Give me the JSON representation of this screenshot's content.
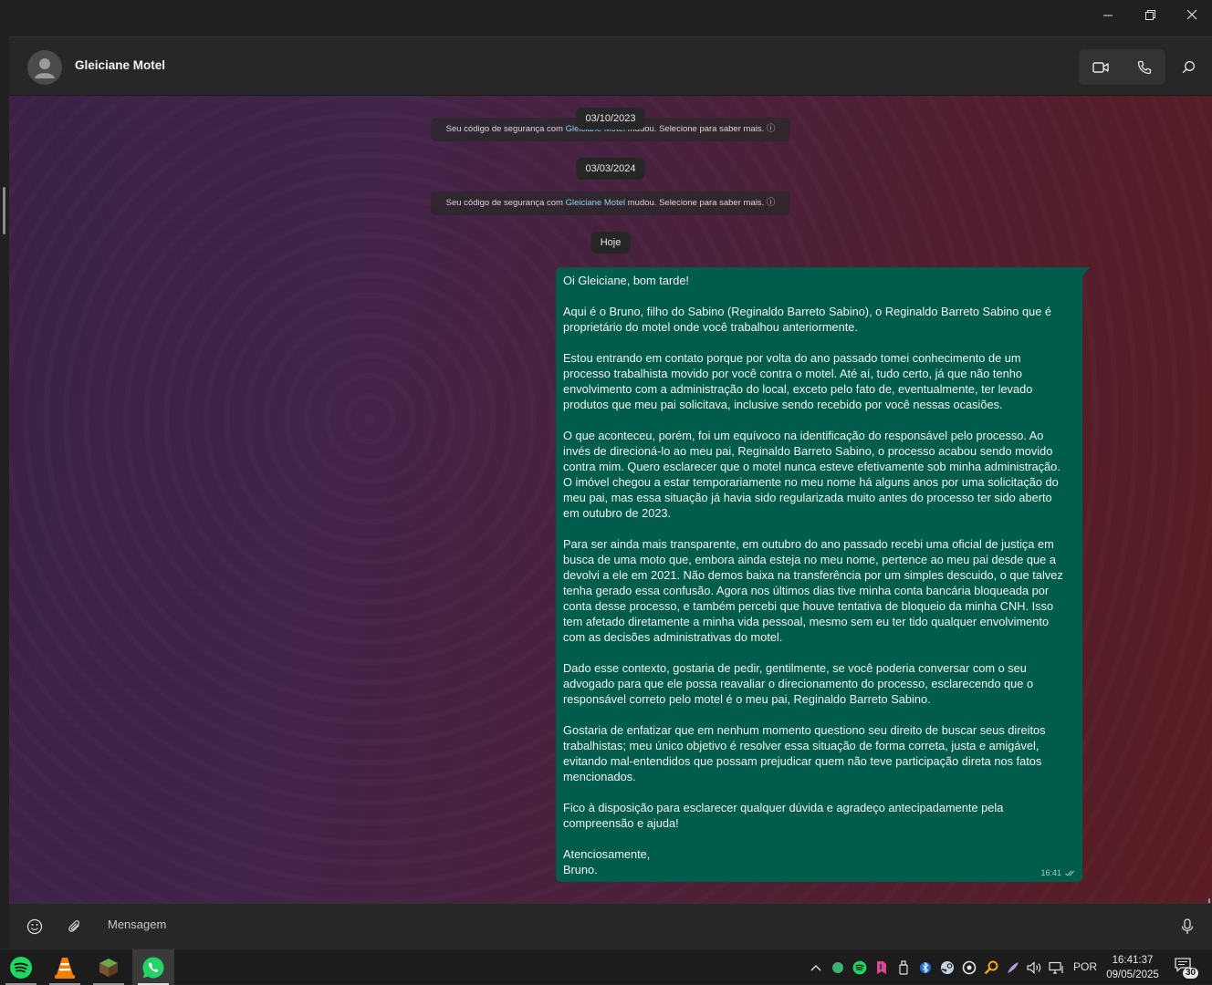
{
  "window": {
    "controls": [
      "minimize",
      "maximize",
      "close"
    ]
  },
  "header": {
    "contact_name": "Gleiciane Motel"
  },
  "timeline": {
    "date1": "03/10/2023",
    "sys1_pre": "Seu código de segurança com ",
    "sys1_link": "Gleiciane Motel",
    "sys1_post": " mudou. Selecione para saber mais. ",
    "date2": "03/03/2024",
    "sys2_pre": "Seu código de segurança com ",
    "sys2_link": "Gleiciane Motel",
    "sys2_post": " mudou. Selecione para saber mais. ",
    "today": "Hoje"
  },
  "message": {
    "text": "Oi Gleiciane, bom tarde!\n\nAqui é o Bruno, filho do Sabino (Reginaldo Barreto Sabino), o Reginaldo Barreto Sabino que é\nproprietário do motel onde você trabalhou anteriormente.\n\nEstou entrando em contato porque por volta do ano passado tomei conhecimento de um\nprocesso trabalhista movido por você contra o motel. Até aí, tudo certo, já que não tenho\nenvolvimento com a administração do local, exceto pelo fato de, eventualmente, ter levado\nprodutos que meu pai solicitava, inclusive sendo recebido por você nessas ocasiões.\n\nO que aconteceu, porém, foi um equívoco na identificação do responsável pelo processo. Ao\ninvés de direcioná-lo ao meu pai, Reginaldo Barreto Sabino, o processo acabou sendo movido\ncontra mim. Quero esclarecer que o motel nunca esteve efetivamente sob minha administração.\nO imóvel chegou a estar temporariamente no meu nome há alguns anos por uma solicitação do\nmeu pai, mas essa situação já havia sido regularizada muito antes do processo ter sido aberto\nem outubro de 2023.\n\nPara ser ainda mais transparente, em outubro do ano passado recebi uma oficial de justiça em\nbusca de uma moto que, embora ainda esteja no meu nome, pertence ao meu pai desde que a\ndevolvi a ele em 2021. Não demos baixa na transferência por um simples descuido, o que talvez\ntenha gerado essa confusão. Agora nos últimos dias tive minha conta bancária bloqueada por\nconta desse processo, e também percebi que houve tentativa de bloqueio da minha CNH. Isso\ntem afetado diretamente a minha vida pessoal, mesmo sem eu ter tido qualquer envolvimento\ncom as decisões administrativas do motel.\n\nDado esse contexto, gostaria de pedir, gentilmente, se você poderia conversar com o seu\nadvogado para que ele possa reavaliar o direcionamento do processo, esclarecendo que o\nresponsável correto pelo motel é o meu pai, Reginaldo Barreto Sabino.\n\nGostaria de enfatizar que em nenhum momento questiono seu direito de buscar seus direitos\ntrabalhistas; meu único objetivo é resolver essa situação de forma correta, justa e amigável,\nevitando mal-entendidos que possam prejudicar quem não teve participação direta nos fatos\nmencionados.\n\nFico à disposição para esclarecer qualquer dúvida e agradeço antecipadamente pela\ncompreensão e ajuda!\n\nAtenciosamente,\nBruno.",
    "time": "16:41",
    "status_icon": "double-check-icon"
  },
  "composer": {
    "placeholder": "Mensagem"
  },
  "taskbar": {
    "apps": [
      "spotify-icon",
      "vlc-icon",
      "minecraft-icon",
      "whatsapp-icon"
    ],
    "language": "POR",
    "time": "16:41:37",
    "date": "09/05/2025",
    "notification_count": "30"
  },
  "colors": {
    "bubble_outgoing": "#005c4b",
    "link": "#8ad4ea",
    "chip_bg": "#262626",
    "spotify": "#1ed760",
    "whatsapp": "#25d366"
  }
}
